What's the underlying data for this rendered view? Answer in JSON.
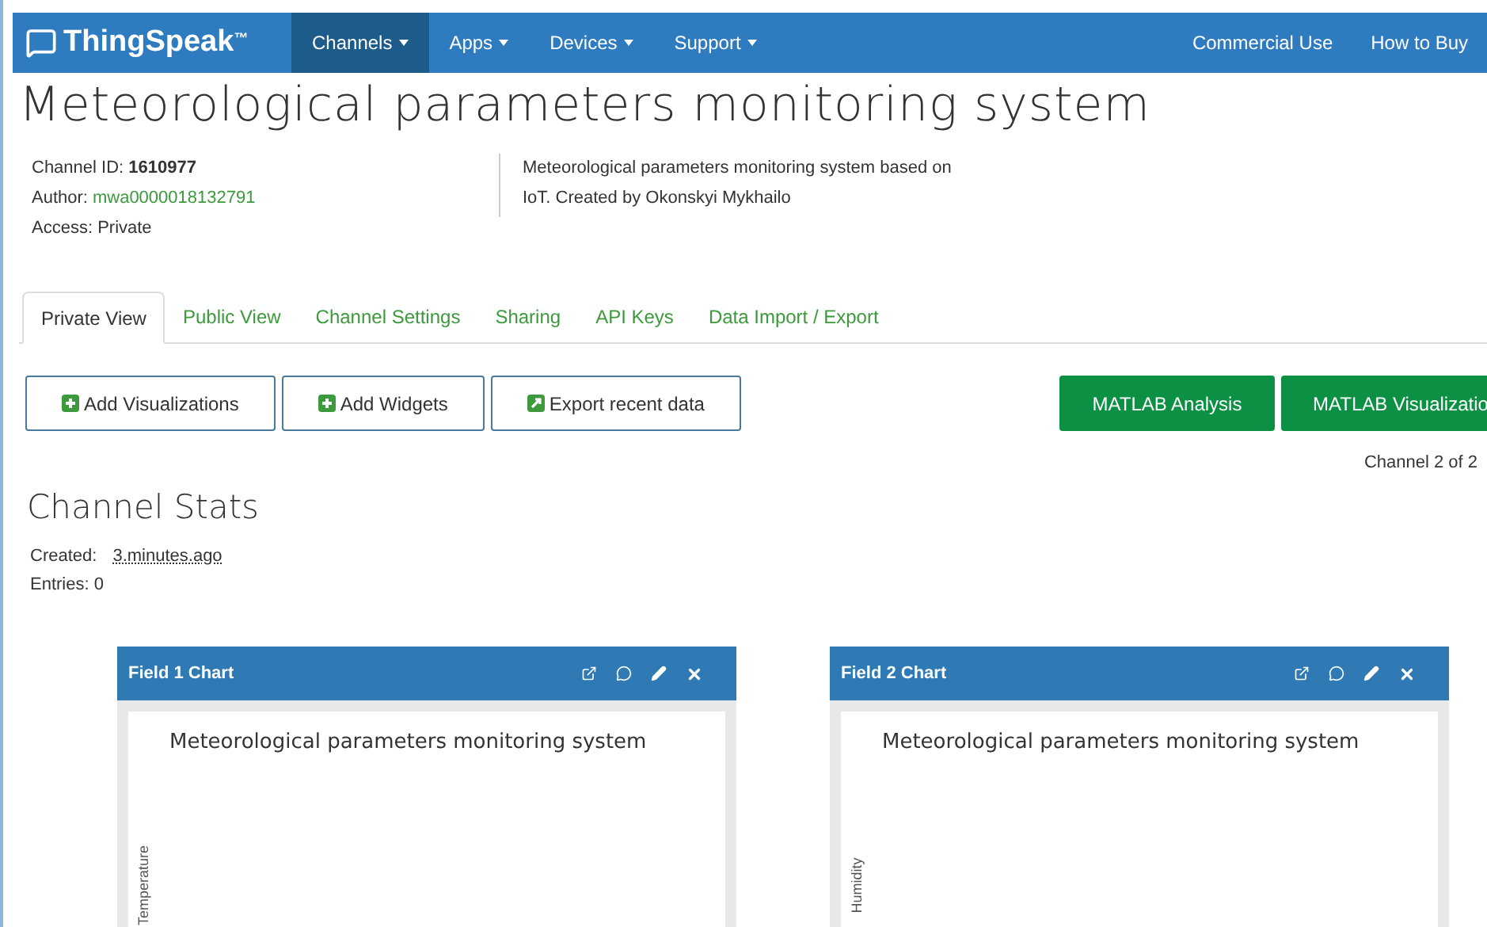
{
  "navbar": {
    "brand": "ThingSpeak",
    "trademark": "™",
    "menu": [
      {
        "label": "Channels",
        "selected": true
      },
      {
        "label": "Apps",
        "selected": false
      },
      {
        "label": "Devices",
        "selected": false
      },
      {
        "label": "Support",
        "selected": false
      }
    ],
    "right_links": [
      "Commercial Use",
      "How to Buy"
    ]
  },
  "title": "Meteorological parameters monitoring system",
  "info": {
    "channel_id_label": "Channel ID:",
    "channel_id": "1610977",
    "author_label": "Author:",
    "author": "mwa0000018132791",
    "access": "Access: Private",
    "description": "Meteorological parameters monitoring system based on IoT. Created by Okonskyi Mykhailo"
  },
  "tabs": [
    {
      "label": "Private View",
      "selected": true
    },
    {
      "label": "Public View",
      "selected": false
    },
    {
      "label": "Channel Settings",
      "selected": false
    },
    {
      "label": "Sharing",
      "selected": false
    },
    {
      "label": "API Keys",
      "selected": false
    },
    {
      "label": "Data Import / Export",
      "selected": false
    }
  ],
  "actions": [
    {
      "label": "Add Visualizations",
      "kind": "plus"
    },
    {
      "label": "Add Widgets",
      "kind": "plus"
    },
    {
      "label": "Export recent data",
      "kind": "export"
    }
  ],
  "matlab_buttons": [
    "MATLAB Analysis",
    "MATLAB Visualizatio"
  ],
  "channel_count": "Channel 2 of 2",
  "stats": {
    "heading": "Channel Stats",
    "created_label": "Created:",
    "created": "3.minutes.ago",
    "entries": "Entries: 0"
  },
  "charts": [
    {
      "header": "Field 1 Chart",
      "title": "Meteorological parameters monitoring system",
      "ylabel": "Temperature"
    },
    {
      "header": "Field 2 Chart",
      "title": "Meteorological parameters monitoring system",
      "ylabel": "Humidity"
    }
  ]
}
